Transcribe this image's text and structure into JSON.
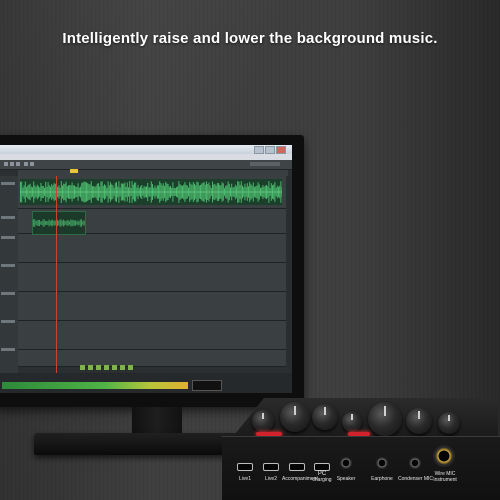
{
  "headline": "Intelligently raise and lower the background music.",
  "colors": {
    "background": "#3e3e3e",
    "waveform_green": "#49b56a",
    "playhead_red": "#c9452f",
    "knob_light_red": "#d2222c"
  },
  "sound_card_ports": [
    {
      "label": "Live1"
    },
    {
      "label": "Live2"
    },
    {
      "label": "Accompaniment"
    },
    {
      "label": "PC",
      "label2": "charging"
    },
    {
      "label": "Speaker"
    },
    {
      "label": "Earphone"
    },
    {
      "label": "Condenser MIC"
    },
    {
      "label": "Wire MIC",
      "label2": "Instrument"
    }
  ]
}
